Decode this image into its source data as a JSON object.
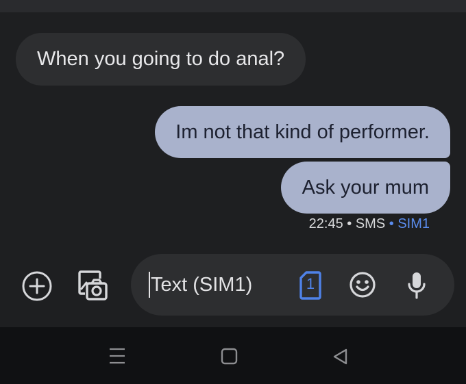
{
  "conversation": {
    "messages": [
      {
        "direction": "incoming",
        "text": "When you going to do anal?"
      },
      {
        "direction": "outgoing",
        "text": "Im not that kind of performer."
      },
      {
        "direction": "outgoing",
        "text": "Ask your mum"
      }
    ],
    "last_meta": {
      "time": "22:45",
      "separator": " • ",
      "channel": "SMS",
      "sim": "SIM1"
    }
  },
  "composer": {
    "placeholder": "Text (SIM1)",
    "sim_badge": "1",
    "icons": [
      "add-icon",
      "gallery-camera-icon",
      "sim-select-icon",
      "emoji-icon",
      "microphone-icon"
    ]
  },
  "navbar": {
    "icons": [
      "recent-apps-icon",
      "home-icon",
      "back-icon"
    ]
  },
  "colors": {
    "background": "#1e1f21",
    "incoming_bubble": "#2d2e30",
    "outgoing_bubble": "#a9b2cc",
    "accent": "#5b8def"
  }
}
